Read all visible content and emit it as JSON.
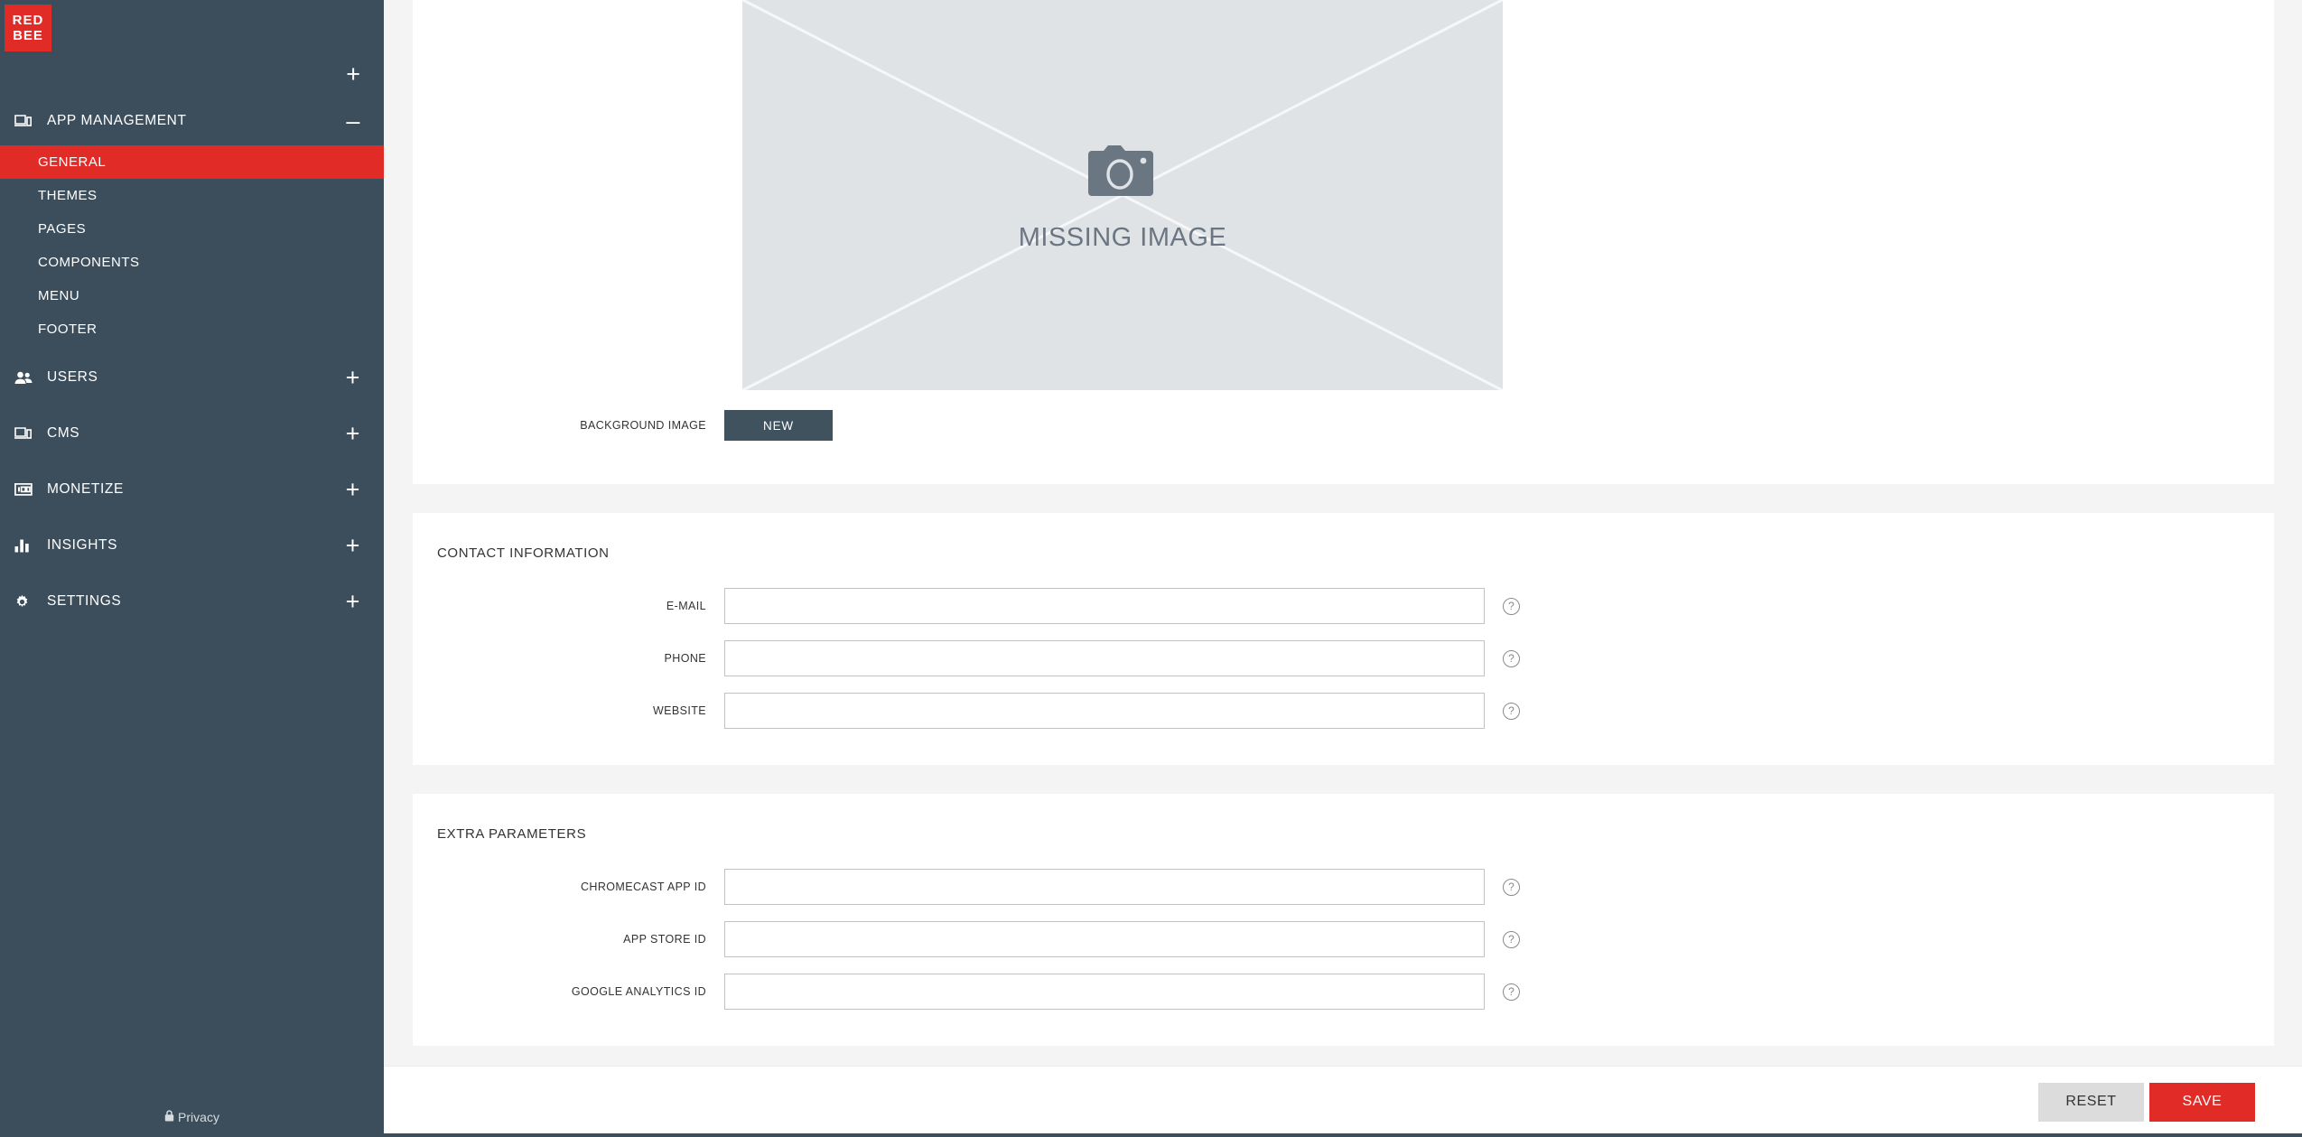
{
  "sidebar": {
    "logo": {
      "line1": "RED",
      "line2": "BEE"
    },
    "add_label": "+",
    "groups": [
      {
        "label": "APP MANAGEMENT",
        "icon": "devices-icon",
        "toggle": "–",
        "expanded": true,
        "children": [
          {
            "label": "GENERAL",
            "active": true
          },
          {
            "label": "THEMES",
            "active": false
          },
          {
            "label": "PAGES",
            "active": false
          },
          {
            "label": "COMPONENTS",
            "active": false
          },
          {
            "label": "MENU",
            "active": false
          },
          {
            "label": "FOOTER",
            "active": false
          }
        ]
      },
      {
        "label": "USERS",
        "icon": "people-icon",
        "toggle": "+",
        "expanded": false,
        "children": []
      },
      {
        "label": "CMS",
        "icon": "devices-icon",
        "toggle": "+",
        "expanded": false,
        "children": []
      },
      {
        "label": "MONETIZE",
        "icon": "money-icon",
        "toggle": "+",
        "expanded": false,
        "children": []
      },
      {
        "label": "INSIGHTS",
        "icon": "bar-chart-icon",
        "toggle": "+",
        "expanded": false,
        "children": []
      },
      {
        "label": "SETTINGS",
        "icon": "gear-icon",
        "toggle": "+",
        "expanded": false,
        "children": []
      }
    ],
    "privacy": {
      "label": "Privacy",
      "icon": "lock-icon"
    }
  },
  "main": {
    "image_card": {
      "placeholder_text": "MISSING IMAGE",
      "placeholder_icon": "camera-icon",
      "field_label": "BACKGROUND IMAGE",
      "new_button": "NEW"
    },
    "contact_section": {
      "title": "CONTACT INFORMATION",
      "fields": [
        {
          "label": "E-MAIL",
          "value": "",
          "placeholder": "",
          "help": "?"
        },
        {
          "label": "PHONE",
          "value": "",
          "placeholder": "",
          "help": "?"
        },
        {
          "label": "WEBSITE",
          "value": "",
          "placeholder": "",
          "help": "?"
        }
      ]
    },
    "extra_section": {
      "title": "EXTRA PARAMETERS",
      "fields": [
        {
          "label": "CHROMECAST APP ID",
          "value": "",
          "placeholder": "",
          "help": "?"
        },
        {
          "label": "APP STORE ID",
          "value": "",
          "placeholder": "",
          "help": "?"
        },
        {
          "label": "GOOGLE ANALYTICS ID",
          "value": "",
          "placeholder": "",
          "help": "?"
        }
      ]
    },
    "actions": {
      "reset": "RESET",
      "save": "SAVE"
    }
  },
  "colors": {
    "sidebar_bg": "#3c4e5c",
    "accent_red": "#e02b27",
    "page_bg": "#f4f4f4",
    "button_dark": "#41525f",
    "reset_gray": "#dcdcdc"
  }
}
